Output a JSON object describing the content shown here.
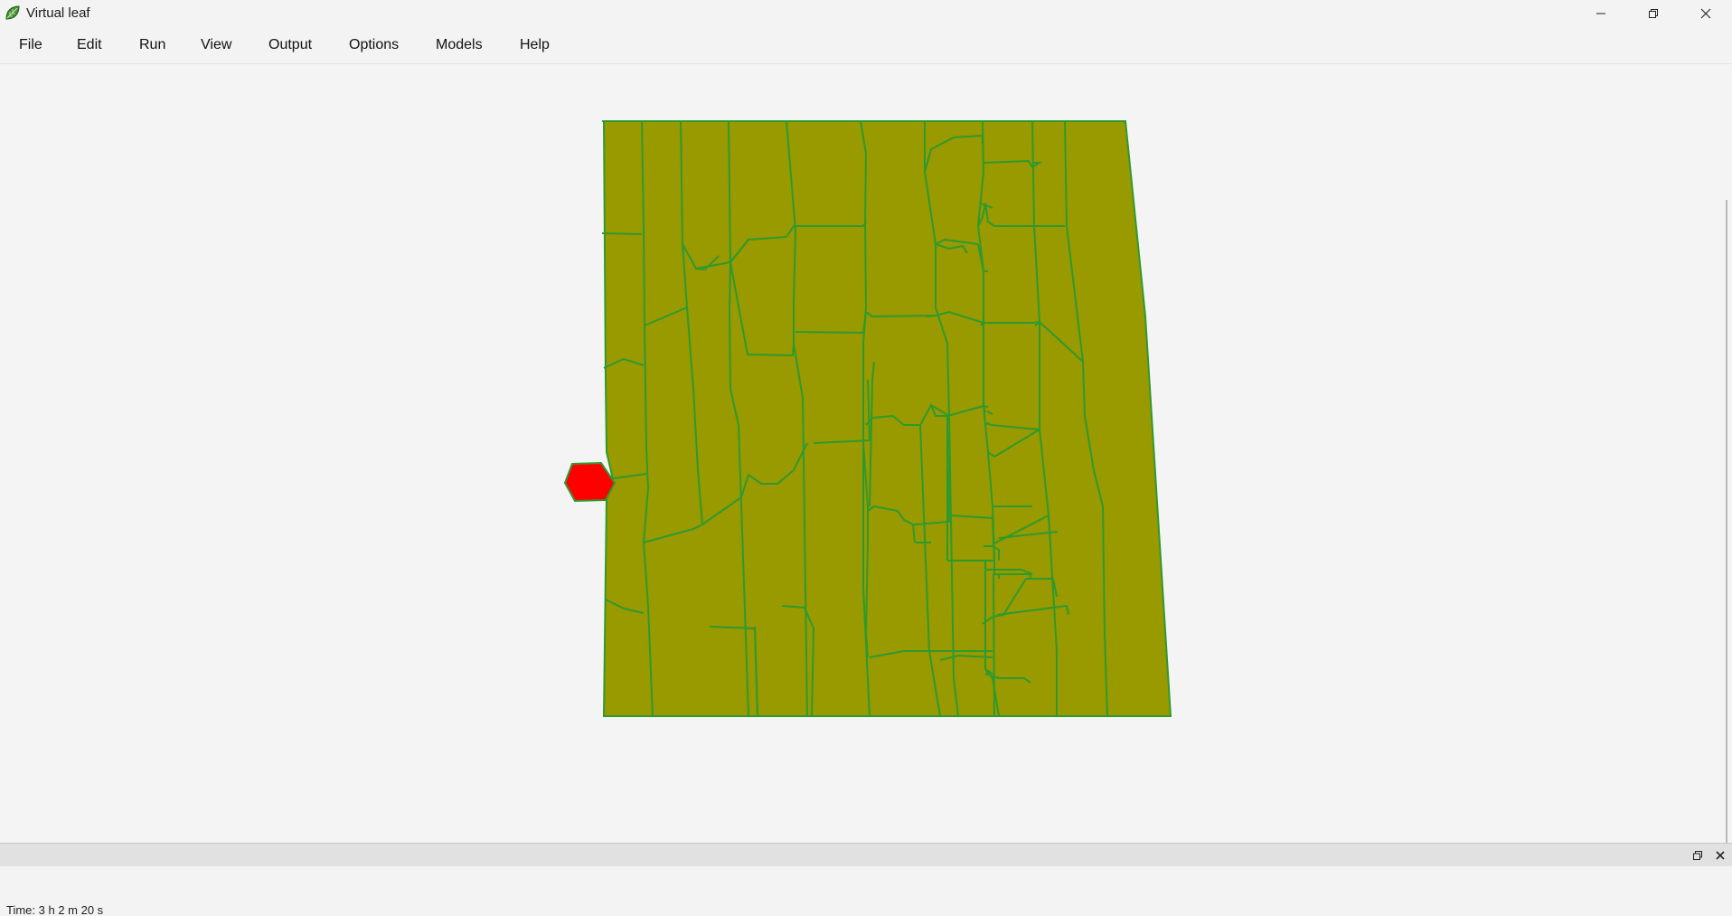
{
  "window": {
    "title": "Virtual leaf",
    "icon": "leaf-icon"
  },
  "menu": {
    "items": [
      "File",
      "Edit",
      "Run",
      "View",
      "Output",
      "Options",
      "Models",
      "Help"
    ]
  },
  "colors": {
    "cell_fill": "#999900",
    "cell_border": "#2e9a2e",
    "highlight_cell": "#ff0000",
    "background": "#f4f4f4"
  },
  "status": {
    "time": "Time: 3 h 2 m 20 s"
  }
}
